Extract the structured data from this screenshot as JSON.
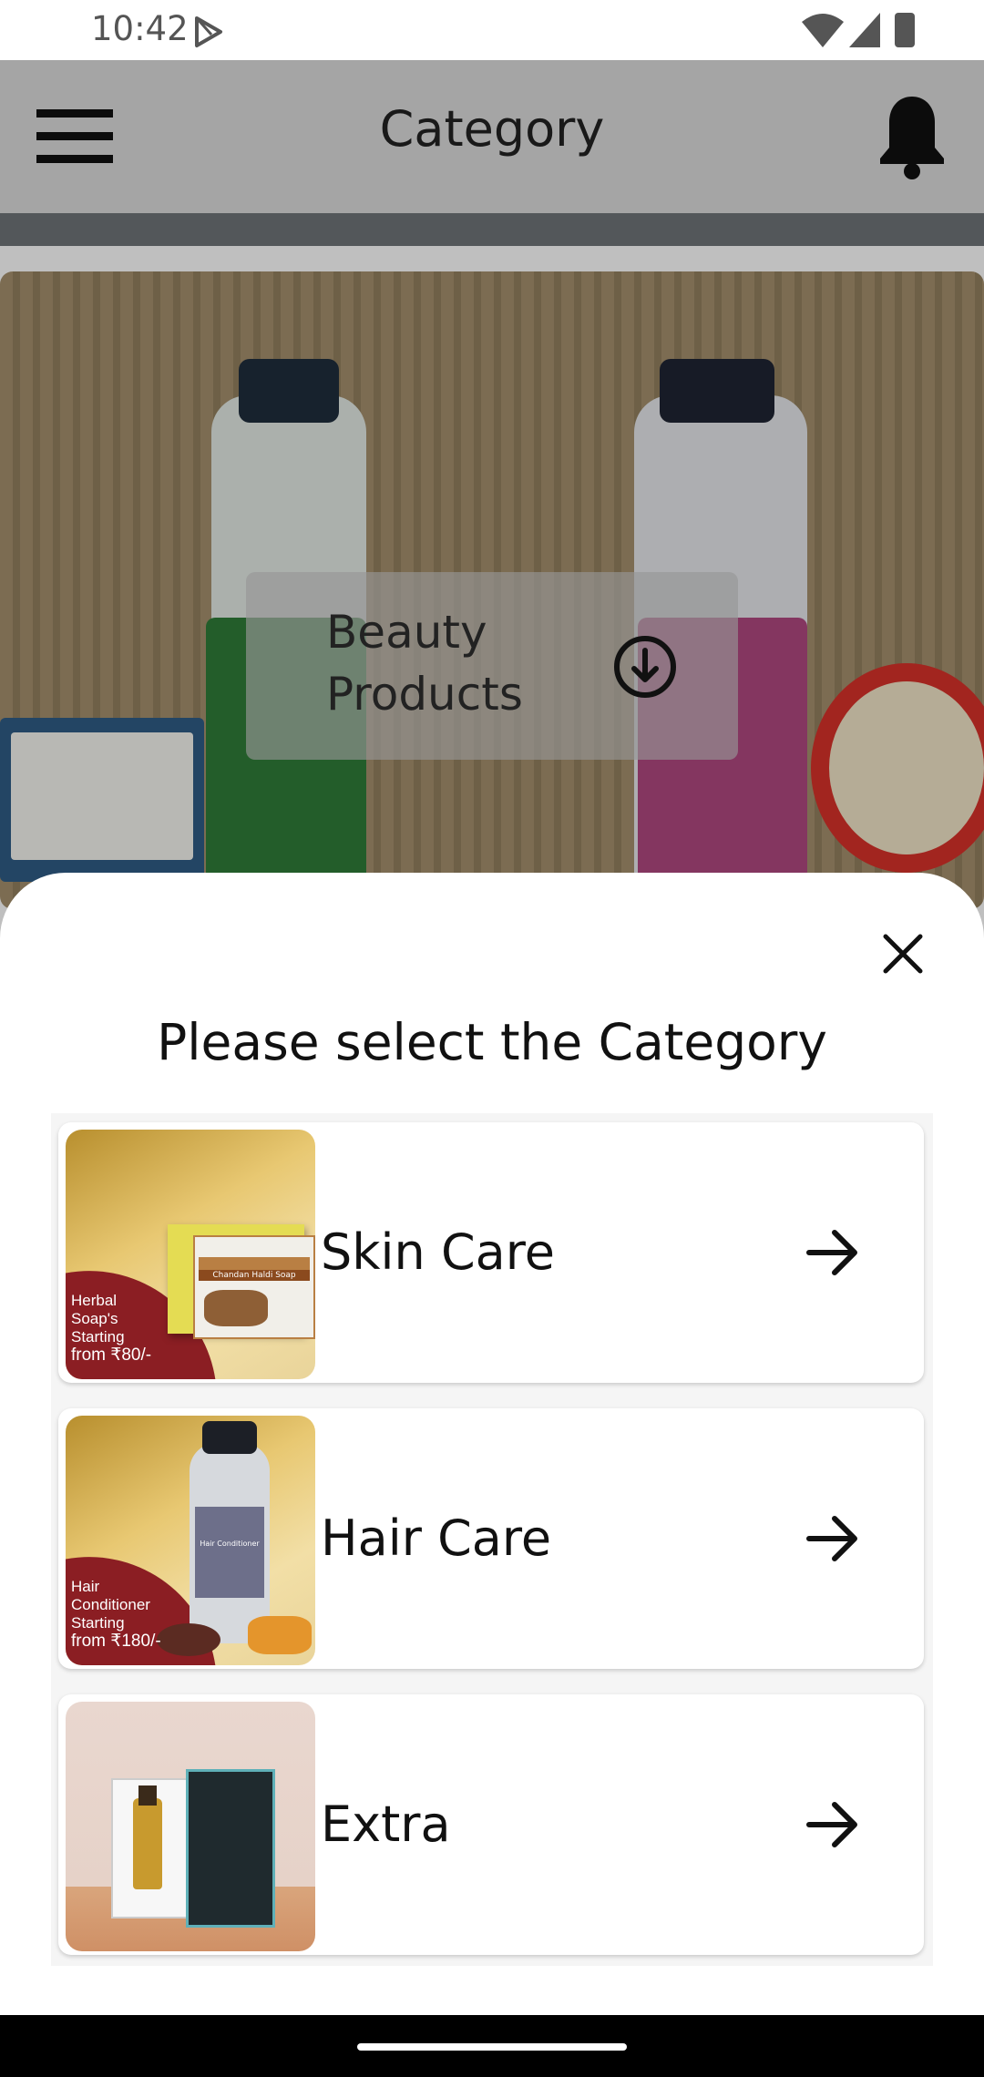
{
  "status_bar": {
    "time": "10:42"
  },
  "header": {
    "title": "Category"
  },
  "banner": {
    "label": "Beauty Products"
  },
  "sheet": {
    "title": "Please select the Category",
    "categories": [
      {
        "label": "Skin Care",
        "promo": [
          "Herbal",
          "Soap's",
          "Starting",
          "from ₹80/-"
        ],
        "product_text": "Chandan Haldi Soap"
      },
      {
        "label": "Hair Care",
        "promo": [
          "Hair",
          "Conditioner",
          "Starting",
          "from ₹180/-"
        ],
        "product_text": "Hair Conditioner"
      },
      {
        "label": "Extra",
        "promo": [],
        "product_text": ""
      }
    ]
  },
  "colors": {
    "accent": "#8b1e23",
    "sheet_bg": "#ffffff",
    "dim_overlay": "rgba(0,0,0,0.25)"
  },
  "icons": [
    "play-store-icon",
    "wifi-icon",
    "signal-icon",
    "battery-icon",
    "menu-icon",
    "bell-icon",
    "download-icon",
    "close-icon",
    "arrow-right-icon"
  ]
}
